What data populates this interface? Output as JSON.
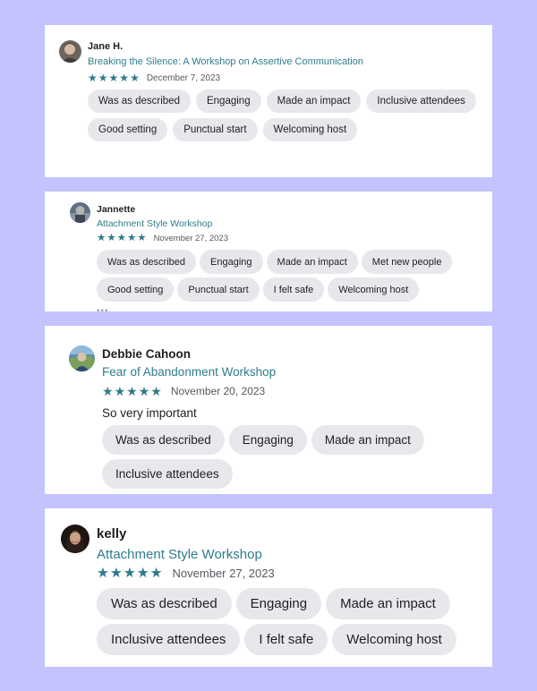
{
  "star_color": "#2f7b8a",
  "event_color": "#2e7d8c",
  "reviews": [
    {
      "reviewer": "Jane H.",
      "event": "Breaking the Silence: A Workshop on Assertive Communication",
      "stars": 5,
      "date": "December 7, 2023",
      "tags": [
        "Was as described",
        "Engaging",
        "Made an impact",
        "Inclusive attendees",
        "Good setting",
        "Punctual start",
        "Welcoming host"
      ]
    },
    {
      "reviewer": "Jannette",
      "event": "Attachment Style Workshop",
      "stars": 5,
      "date": "November 27, 2023",
      "tags": [
        "Was as described",
        "Engaging",
        "Made an impact",
        "Met new people",
        "Good setting",
        "Punctual start",
        "I felt safe",
        "Welcoming host"
      ]
    },
    {
      "reviewer": "Debbie Cahoon",
      "event": "Fear of Abandonment Workshop",
      "stars": 5,
      "date": "November 20, 2023",
      "comment": "So very important",
      "tags": [
        "Was as described",
        "Engaging",
        "Made an impact",
        "Inclusive attendees"
      ]
    },
    {
      "reviewer": "kelly",
      "event": "Attachment Style Workshop",
      "stars": 5,
      "date": "November 27, 2023",
      "tags": [
        "Was as described",
        "Engaging",
        "Made an impact",
        "Inclusive attendees",
        "I felt safe",
        "Welcoming host"
      ]
    }
  ]
}
